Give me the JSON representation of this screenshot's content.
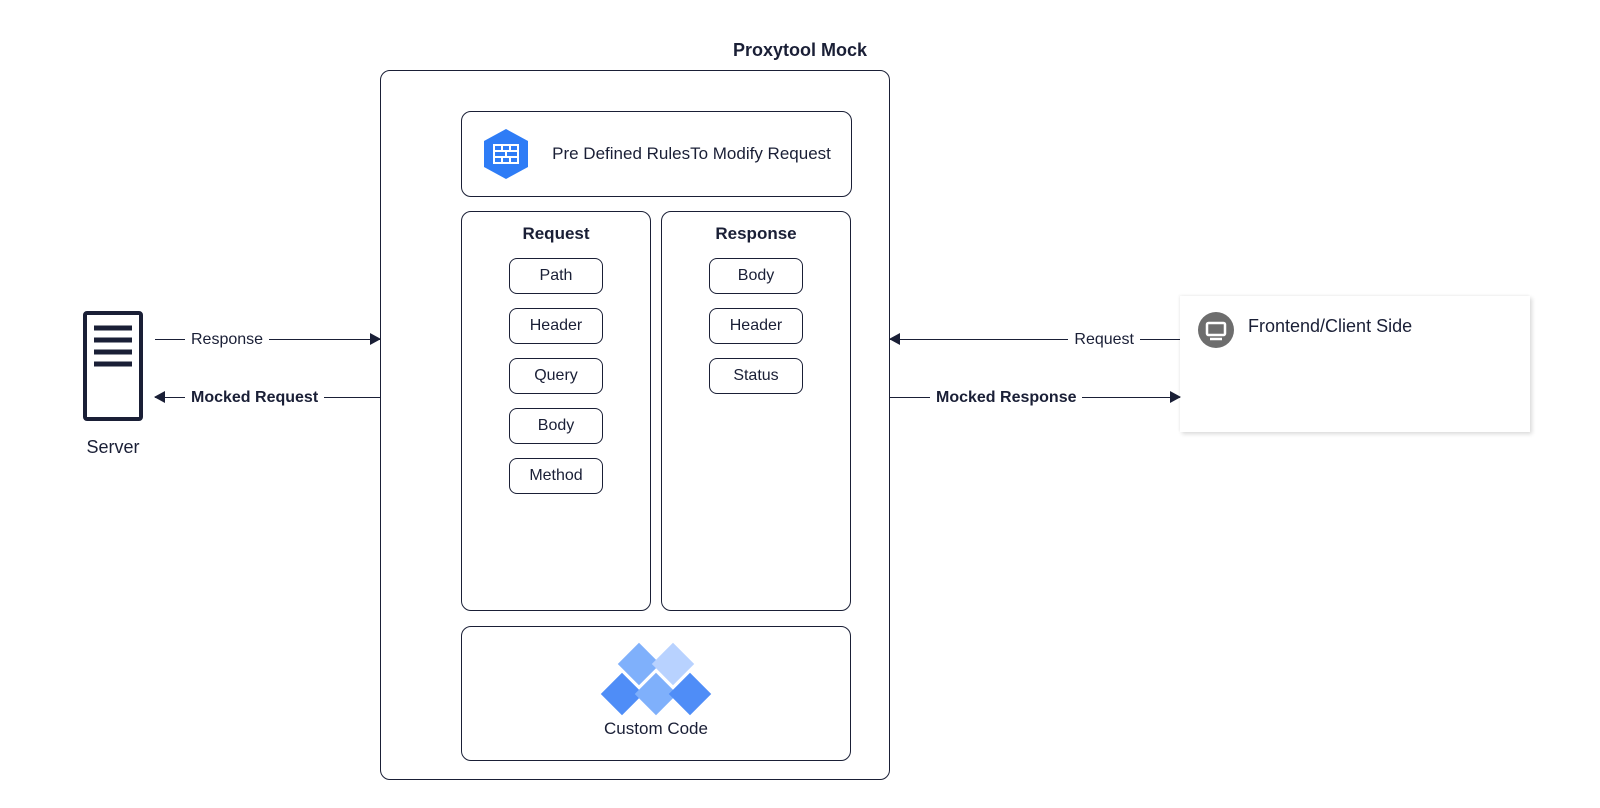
{
  "title": "Proxytool Mock",
  "server": {
    "label": "Server"
  },
  "rules": {
    "text": "Pre Defined RulesTo Modify Request"
  },
  "request": {
    "title": "Request",
    "items": [
      "Path",
      "Header",
      "Query",
      "Body",
      "Method"
    ]
  },
  "response": {
    "title": "Response",
    "items": [
      "Body",
      "Header",
      "Status"
    ]
  },
  "custom": {
    "label": "Custom Code"
  },
  "client": {
    "label": "Frontend/Client Side"
  },
  "connectors": {
    "server_response": "Response",
    "mocked_request": "Mocked Request",
    "client_request": "Request",
    "mocked_response": "Mocked Response"
  },
  "colors": {
    "accent_blue": "#2e7cf6",
    "diamond_mid": "#7fb0fb",
    "diamond_light": "#b8d2ff",
    "stroke": "#1a1f36",
    "client_icon_bg": "#6d6d6d"
  }
}
